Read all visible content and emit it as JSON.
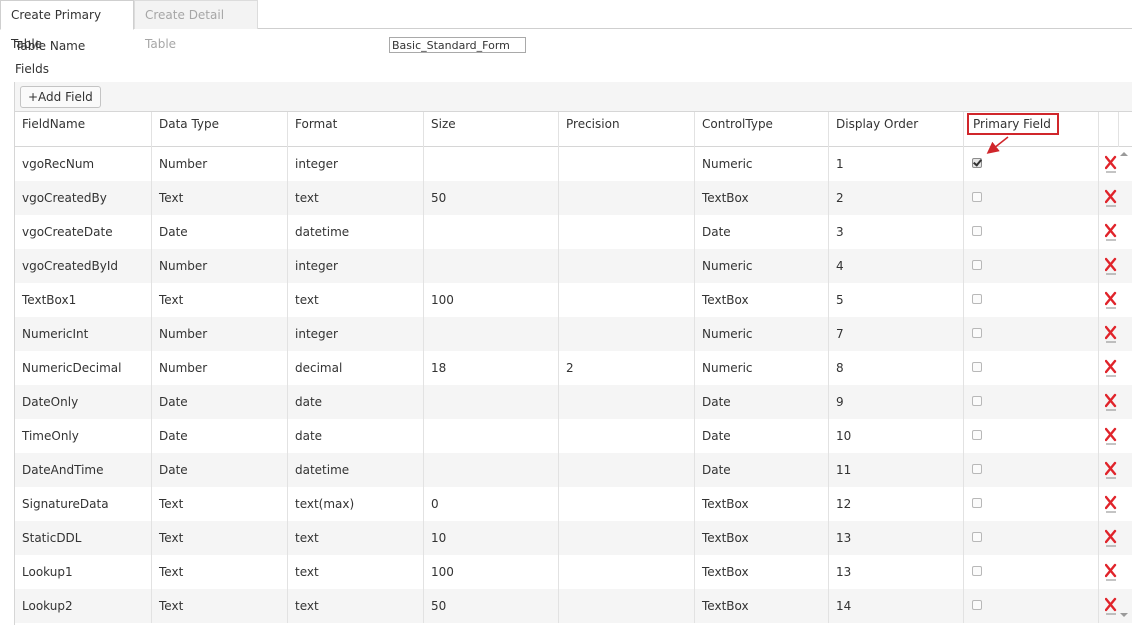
{
  "tabs": [
    {
      "label": "Create Primary Table",
      "active": true
    },
    {
      "label": "Create Detail Table",
      "active": false
    }
  ],
  "form": {
    "table_name_label": "Table Name",
    "table_name_value": "Basic_Standard_Form",
    "fields_label": "Fields"
  },
  "toolbar": {
    "add_field_label": "+Add Field"
  },
  "columns": [
    "FieldName",
    "Data Type",
    "Format",
    "Size",
    "Precision",
    "ControlType",
    "Display Order",
    "Primary Field"
  ],
  "rows": [
    {
      "field": "vgoRecNum",
      "type": "Number",
      "format": "integer",
      "size": "",
      "precision": "",
      "control": "Numeric",
      "order": "1",
      "primary": true
    },
    {
      "field": "vgoCreatedBy",
      "type": "Text",
      "format": "text",
      "size": "50",
      "precision": "",
      "control": "TextBox",
      "order": "2",
      "primary": false
    },
    {
      "field": "vgoCreateDate",
      "type": "Date",
      "format": "datetime",
      "size": "",
      "precision": "",
      "control": "Date",
      "order": "3",
      "primary": false
    },
    {
      "field": "vgoCreatedById",
      "type": "Number",
      "format": "integer",
      "size": "",
      "precision": "",
      "control": "Numeric",
      "order": "4",
      "primary": false
    },
    {
      "field": "TextBox1",
      "type": "Text",
      "format": "text",
      "size": "100",
      "precision": "",
      "control": "TextBox",
      "order": "5",
      "primary": false
    },
    {
      "field": "NumericInt",
      "type": "Number",
      "format": "integer",
      "size": "",
      "precision": "",
      "control": "Numeric",
      "order": "7",
      "primary": false
    },
    {
      "field": "NumericDecimal",
      "type": "Number",
      "format": "decimal",
      "size": "18",
      "precision": "2",
      "control": "Numeric",
      "order": "8",
      "primary": false
    },
    {
      "field": "DateOnly",
      "type": "Date",
      "format": "date",
      "size": "",
      "precision": "",
      "control": "Date",
      "order": "9",
      "primary": false
    },
    {
      "field": "TimeOnly",
      "type": "Date",
      "format": "date",
      "size": "",
      "precision": "",
      "control": "Date",
      "order": "10",
      "primary": false
    },
    {
      "field": "DateAndTime",
      "type": "Date",
      "format": "datetime",
      "size": "",
      "precision": "",
      "control": "Date",
      "order": "11",
      "primary": false
    },
    {
      "field": "SignatureData",
      "type": "Text",
      "format": "text(max)",
      "size": "0",
      "precision": "",
      "control": "TextBox",
      "order": "12",
      "primary": false
    },
    {
      "field": "StaticDDL",
      "type": "Text",
      "format": "text",
      "size": "10",
      "precision": "",
      "control": "TextBox",
      "order": "13",
      "primary": false
    },
    {
      "field": "Lookup1",
      "type": "Text",
      "format": "text",
      "size": "100",
      "precision": "",
      "control": "TextBox",
      "order": "13",
      "primary": false
    },
    {
      "field": "Lookup2",
      "type": "Text",
      "format": "text",
      "size": "50",
      "precision": "",
      "control": "TextBox",
      "order": "14",
      "primary": false
    }
  ],
  "icons": {
    "delete": "delete-x-icon",
    "scroll_up": "scroll-up-arrow-icon",
    "scroll_down": "scroll-down-arrow-icon"
  },
  "colors": {
    "highlight": "#d0262b",
    "delete": "#e0242b",
    "row_alt": "#f5f5f5"
  }
}
